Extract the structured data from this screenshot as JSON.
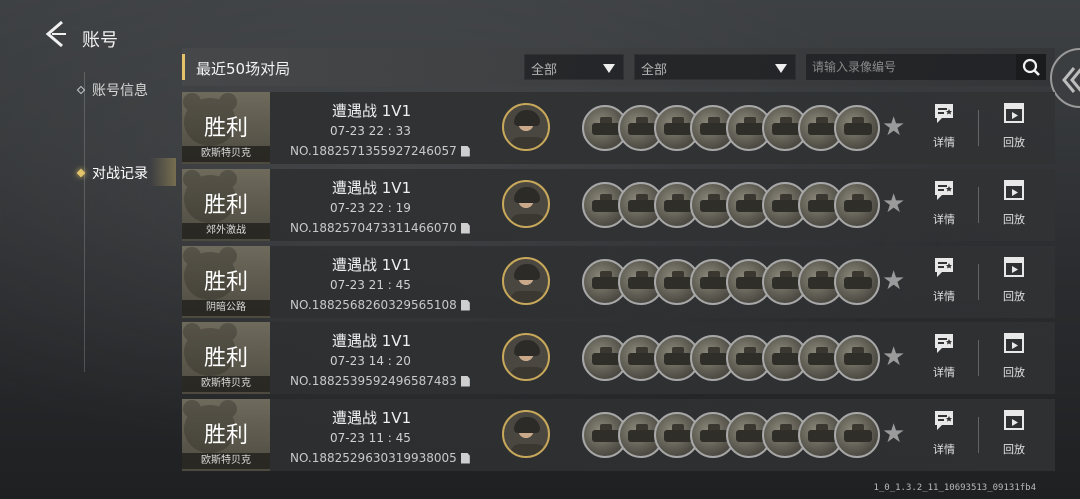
{
  "title": "账号",
  "nav": {
    "items": [
      {
        "label": "账号信息",
        "active": false
      },
      {
        "label": "对战记录",
        "active": true
      }
    ]
  },
  "header": {
    "title": "最近50场对局",
    "filter1": "全部",
    "filter2": "全部",
    "search_placeholder": "请输入录像编号"
  },
  "matches": [
    {
      "result": "胜利",
      "map": "欧斯特贝克",
      "mode": "遭遇战 1V1",
      "time": "07-23  22 : 33",
      "no": "NO.1882571355927246057"
    },
    {
      "result": "胜利",
      "map": "郊外激战",
      "mode": "遭遇战 1V1",
      "time": "07-23  22 : 19",
      "no": "NO.1882570473311466070"
    },
    {
      "result": "胜利",
      "map": "阴暗公路",
      "mode": "遭遇战 1V1",
      "time": "07-23  21 : 45",
      "no": "NO.1882568260329565108"
    },
    {
      "result": "胜利",
      "map": "欧斯特贝克",
      "mode": "遭遇战 1V1",
      "time": "07-23  14 : 20",
      "no": "NO.1882539592496587483"
    },
    {
      "result": "胜利",
      "map": "欧斯特贝克",
      "mode": "遭遇战 1V1",
      "time": "07-23  11 : 45",
      "no": "NO.1882529630319938005"
    }
  ],
  "actions": {
    "detail": "详情",
    "replay": "回放"
  },
  "version": "1_0_1.3.2_11_10693513_09131fb4",
  "colors": {
    "accent": "#e3c46b",
    "avatar_border": "#c8a85a"
  }
}
